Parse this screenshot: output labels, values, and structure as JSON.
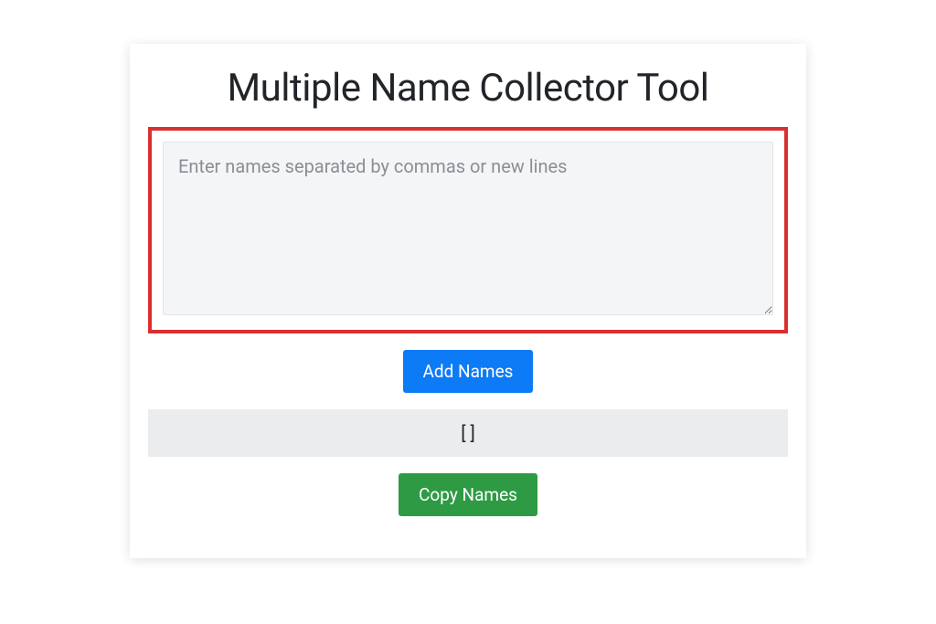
{
  "title": "Multiple Name Collector Tool",
  "input": {
    "placeholder": "Enter names separated by commas or new lines",
    "value": ""
  },
  "buttons": {
    "add_label": "Add Names",
    "copy_label": "Copy Names"
  },
  "output": {
    "value": "[ ]"
  },
  "colors": {
    "highlight_border": "#d93030",
    "primary": "#0d7af6",
    "success": "#2e9b44"
  }
}
